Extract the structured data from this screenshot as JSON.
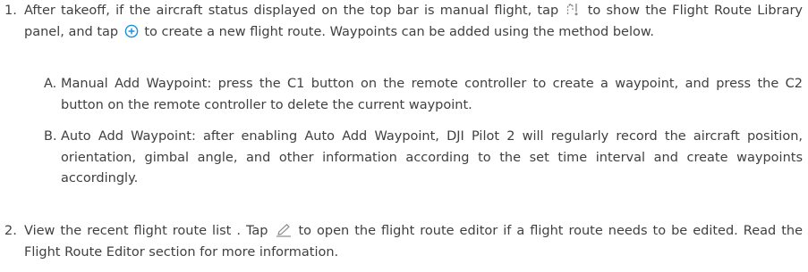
{
  "steps": [
    {
      "number": "1.",
      "part1": "After takeoff, if the aircraft status displayed on the top bar is manual flight, tap",
      "icon1": "route-library-icon",
      "part2": "to show the Flight Route Library panel, and tap",
      "icon2": "add-circle-icon",
      "part3": "to create a new flight route. Waypoints can be added using the method below.",
      "substeps": [
        {
          "letter": "A.",
          "text": "Manual Add Waypoint: press the C1 button on the remote controller to create a waypoint, and press the C2 button on the remote controller to delete the current waypoint."
        },
        {
          "letter": "B.",
          "text": "Auto Add Waypoint: after enabling Auto Add Waypoint, DJI Pilot 2 will regularly record the aircraft position, orientation, gimbal angle, and other information according to the set time interval and create waypoints accordingly."
        }
      ]
    },
    {
      "number": "2.",
      "part1": "View the recent flight route list . Tap",
      "icon1": "edit-pencil-icon",
      "part2": "to open the flight route editor if a flight route needs to be edited. Read the Flight Route Editor section for more information."
    }
  ],
  "colors": {
    "text": "#404040",
    "accent": "#1a8fd6",
    "icon_gray": "#8a8a8a"
  }
}
